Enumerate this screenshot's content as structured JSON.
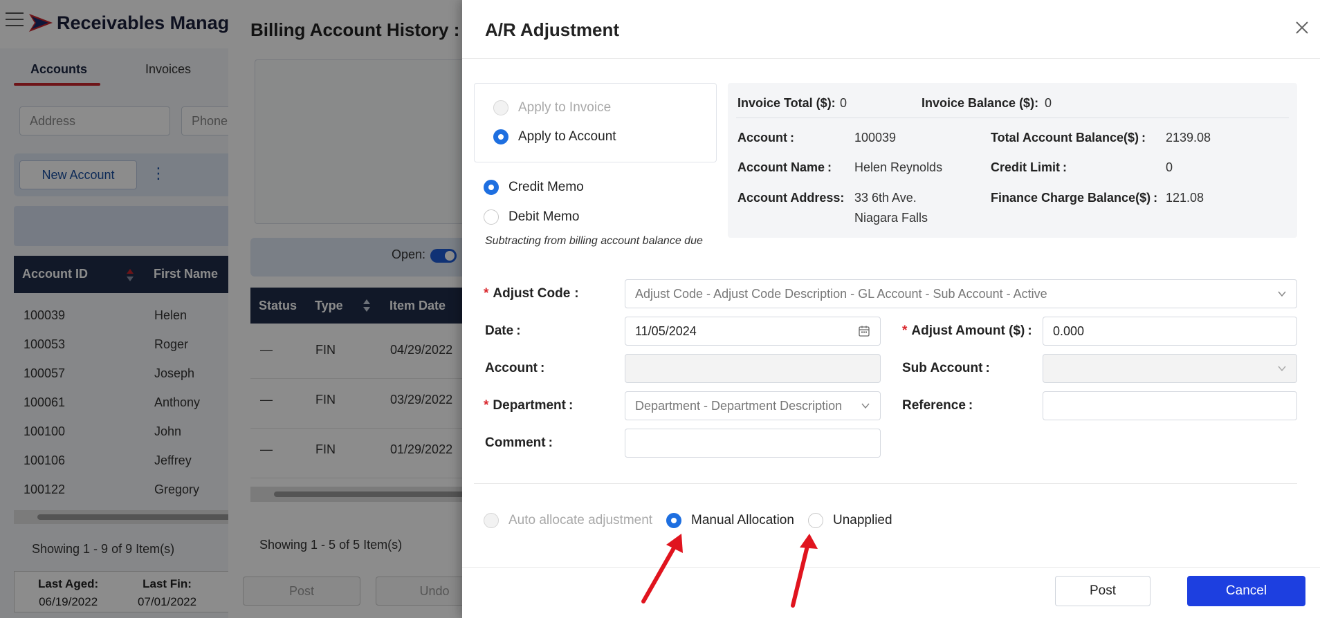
{
  "app": {
    "title": "Receivables Manag",
    "tabs": [
      "Accounts",
      "Invoices"
    ],
    "filters": {
      "address_placeholder": "Address",
      "phone_placeholder": "Phone"
    },
    "new_account_label": "New Account",
    "kebab": "⋮",
    "grid": {
      "columns": [
        "Account ID",
        "First Name"
      ],
      "rows": [
        [
          "100039",
          "Helen"
        ],
        [
          "100053",
          "Roger"
        ],
        [
          "100057",
          "Joseph"
        ],
        [
          "100061",
          "Anthony"
        ],
        [
          "100100",
          "John"
        ],
        [
          "100106",
          "Jeffrey"
        ],
        [
          "100122",
          "Gregory"
        ]
      ]
    },
    "showing": "Showing 1 - 9 of 9 Item(s)",
    "stats": [
      {
        "label": "Last Aged:",
        "value": "06/19/2022"
      },
      {
        "label": "Last Fin:",
        "value": "07/01/2022"
      }
    ]
  },
  "history": {
    "title": "Billing Account History :",
    "open_label": "Open:",
    "columns": [
      "Status",
      "Type",
      "Item Date"
    ],
    "rows": [
      [
        "—",
        "FIN",
        "04/29/2022"
      ],
      [
        "—",
        "FIN",
        "03/29/2022"
      ],
      [
        "—",
        "FIN",
        "01/29/2022"
      ]
    ],
    "showing": "Showing 1 - 5 of 5 Item(s)",
    "buttons": {
      "post": "Post",
      "undo": "Undo"
    }
  },
  "modal": {
    "title": "A/R Adjustment",
    "apply_options": [
      "Apply to Invoice",
      "Apply to Account"
    ],
    "memo_options": [
      "Credit Memo",
      "Debit Memo"
    ],
    "hint": "Subtracting from billing account balance due",
    "info": {
      "invoice_total_label": "Invoice Total ($):",
      "invoice_total": "0",
      "invoice_balance_label": "Invoice Balance ($):",
      "invoice_balance": "0",
      "account_label": "Account",
      "account": "100039",
      "account_name_label": "Account Name",
      "account_name": "Helen Reynolds",
      "account_address_label": "Account Address",
      "address_line1": "33 6th Ave.",
      "address_line2": "Niagara Falls",
      "total_balance_label": "Total Account Balance($)",
      "total_balance": "2139.08",
      "credit_limit_label": "Credit Limit",
      "credit_limit": "0",
      "finance_balance_label": "Finance Charge Balance($)",
      "finance_balance": "121.08",
      "colon": ":"
    },
    "form": {
      "adjust_code_label": "Adjust Code",
      "adjust_code_placeholder": "Adjust Code - Adjust Code Description - GL Account - Sub Account - Active",
      "date_label": "Date",
      "date_value": "11/05/2024",
      "adjust_amount_label": "Adjust Amount ($)",
      "adjust_amount_value": "0.000",
      "account_label": "Account",
      "account_value": "",
      "sub_account_label": "Sub Account",
      "sub_account_value": "",
      "department_label": "Department",
      "department_placeholder": "Department - Department Description",
      "reference_label": "Reference",
      "reference_value": "",
      "comment_label": "Comment",
      "comment_value": "",
      "colon": ":",
      "required_mark": "*"
    },
    "allocation_options": [
      "Auto allocate adjustment",
      "Manual Allocation",
      "Unapplied"
    ],
    "buttons": {
      "post": "Post",
      "cancel": "Cancel"
    }
  },
  "colors": {
    "primary": "#1d3fe0",
    "radio_checked": "#1e6fe0",
    "required": "#d9262c",
    "annotation_arrow": "#e0141e",
    "nav_dark": "#1f2d4a",
    "tab_underline": "#c9262c"
  },
  "icons": [
    "menu-icon",
    "logo-icon",
    "close-icon",
    "chevron-down-icon",
    "calendar-icon",
    "sort-icon",
    "annotation-arrow"
  ]
}
